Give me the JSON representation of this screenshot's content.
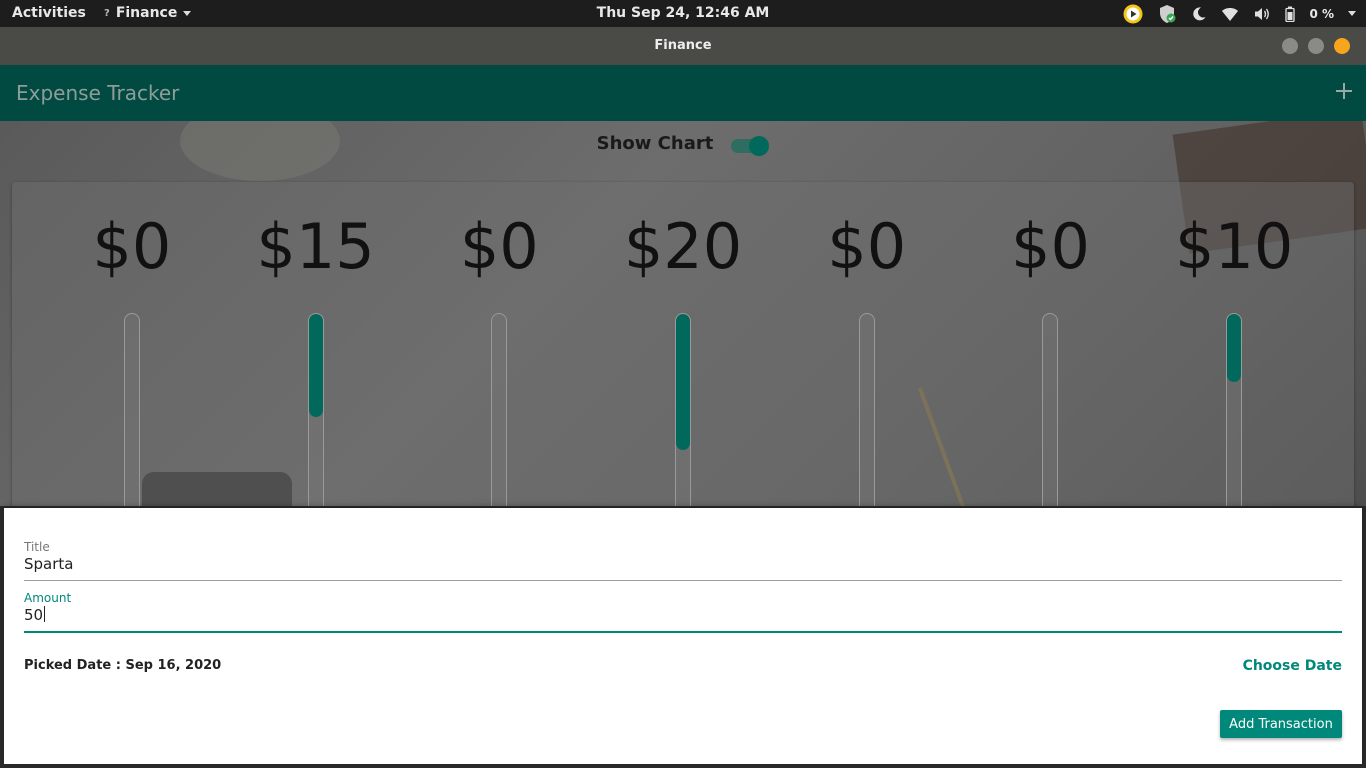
{
  "topbar": {
    "activities": "Activities",
    "app_menu": "Finance",
    "clock": "Thu Sep 24, 12:46 AM",
    "battery_percent": "0 %",
    "icons": [
      "media-player-icon",
      "shield-update-icon",
      "night-mode-icon",
      "wifi-icon",
      "volume-icon",
      "battery-icon"
    ]
  },
  "window": {
    "title": "Finance"
  },
  "appbar": {
    "title": "Expense Tracker",
    "add_icon": "plus-icon"
  },
  "chart_toggle": {
    "label": "Show Chart",
    "on": true
  },
  "chart_data": {
    "type": "bar",
    "orientation": "vertical-progress",
    "labels": [
      "$0",
      "$15",
      "$0",
      "$20",
      "$0",
      "$0",
      "$10"
    ],
    "values": [
      0,
      15,
      0,
      20,
      0,
      0,
      10
    ],
    "fill_fraction": [
      0,
      0.47,
      0,
      0.62,
      0,
      0,
      0.31
    ],
    "color": "#00695c"
  },
  "form": {
    "title_label": "Title",
    "title_value": "Sparta",
    "amount_label": "Amount",
    "amount_value": "50",
    "picked_date": "Picked Date : Sep 16, 2020",
    "choose_date": "Choose Date",
    "submit": "Add Transaction"
  },
  "colors": {
    "primary": "#004a41",
    "accent": "#00897b",
    "bar": "#00695c"
  }
}
